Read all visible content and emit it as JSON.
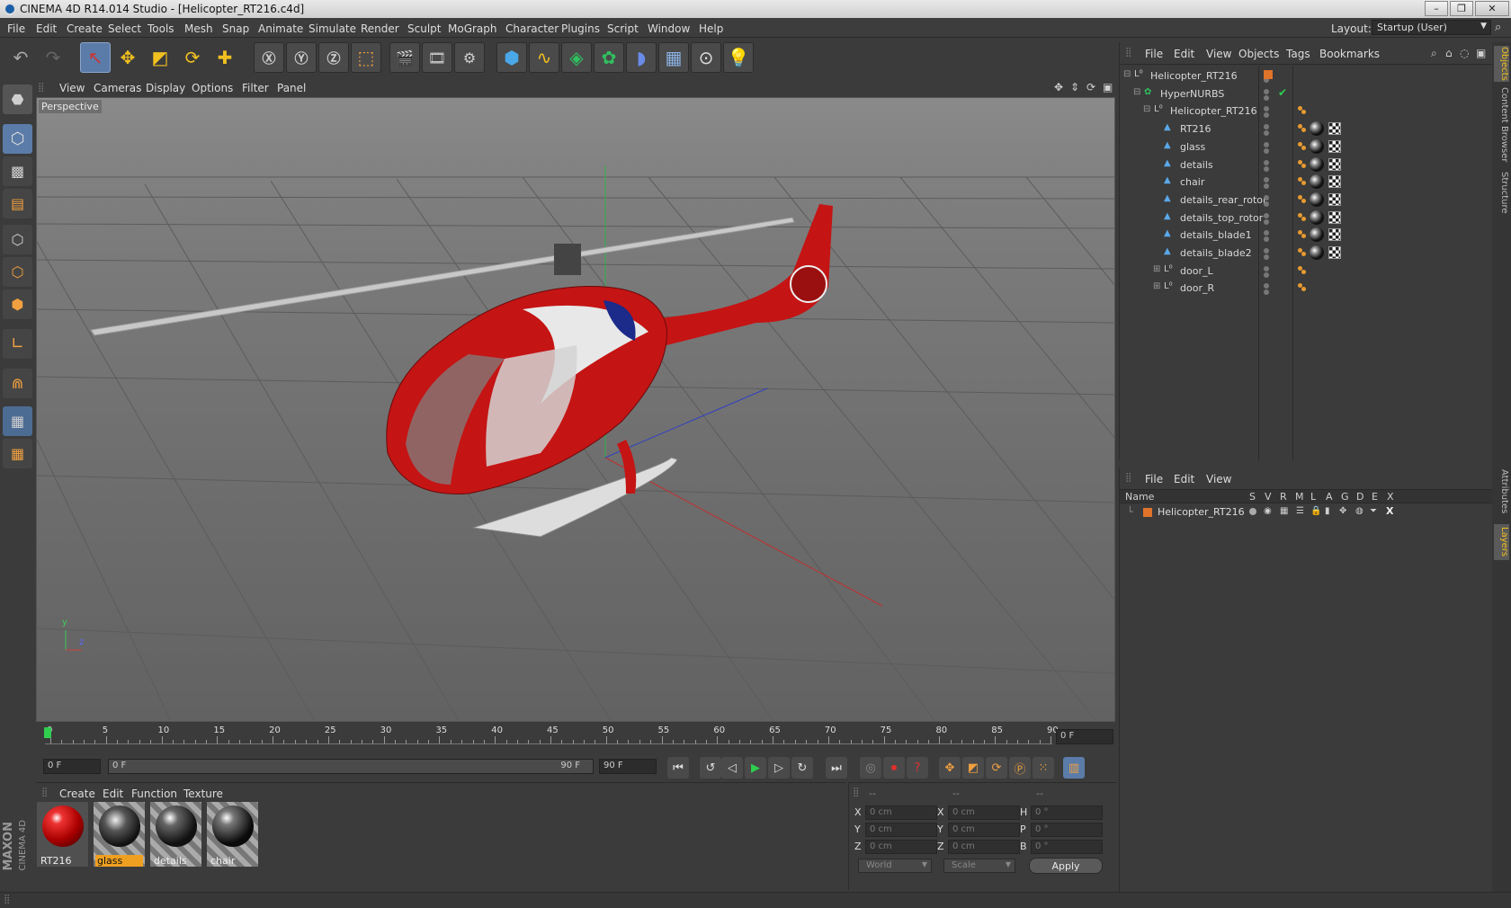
{
  "window": {
    "title": "CINEMA 4D R14.014 Studio - [Helicopter_RT216.c4d]"
  },
  "menubar": [
    "File",
    "Edit",
    "Create",
    "Select",
    "Tools",
    "Mesh",
    "Snap",
    "Animate",
    "Simulate",
    "Render",
    "Sculpt",
    "MoGraph",
    "Character",
    "Plugins",
    "Script",
    "Window",
    "Help"
  ],
  "layout": {
    "label": "Layout:",
    "value": "Startup (User)"
  },
  "viewport": {
    "menu": [
      "View",
      "Cameras",
      "Display",
      "Options",
      "Filter",
      "Panel"
    ],
    "label": "Perspective",
    "axis_y": "y",
    "axis_z": "z"
  },
  "objects_panel": {
    "menu": [
      "File",
      "Edit",
      "View",
      "Objects",
      "Tags",
      "Bookmarks"
    ],
    "items": [
      {
        "name": "Helicopter_RT216",
        "type": "null"
      },
      {
        "name": "HyperNURBS",
        "type": "hypernurbs"
      },
      {
        "name": "Helicopter_RT216",
        "type": "null"
      },
      {
        "name": "RT216",
        "type": "mesh"
      },
      {
        "name": "glass",
        "type": "mesh"
      },
      {
        "name": "details",
        "type": "mesh"
      },
      {
        "name": "chair",
        "type": "mesh"
      },
      {
        "name": "details_rear_rotor",
        "type": "mesh"
      },
      {
        "name": "details_top_rotor",
        "type": "mesh"
      },
      {
        "name": "details_blade1",
        "type": "mesh"
      },
      {
        "name": "details_blade2",
        "type": "mesh"
      },
      {
        "name": "door_L",
        "type": "null"
      },
      {
        "name": "door_R",
        "type": "null"
      }
    ]
  },
  "layers_panel": {
    "menu": [
      "File",
      "Edit",
      "View"
    ],
    "header": {
      "name": "Name",
      "flags": [
        "S",
        "V",
        "R",
        "M",
        "L",
        "A",
        "G",
        "D",
        "E",
        "X"
      ]
    },
    "rows": [
      {
        "name": "Helicopter_RT216",
        "color": "#e0742a"
      }
    ]
  },
  "side_tabs": [
    "Objects",
    "Content Browser",
    "Structure",
    "Attributes",
    "Layers"
  ],
  "timeline": {
    "ticks": [
      "0",
      "5",
      "10",
      "15",
      "20",
      "25",
      "30",
      "35",
      "40",
      "45",
      "50",
      "55",
      "60",
      "65",
      "70",
      "75",
      "80",
      "85",
      "90"
    ],
    "current_frame": "0 F",
    "start_field": "0 F",
    "range_left": "0 F",
    "range_right": "90 F",
    "end_field": "90 F"
  },
  "materials": {
    "menu": [
      "Create",
      "Edit",
      "Function",
      "Texture"
    ],
    "items": [
      {
        "name": "RT216",
        "selected": false
      },
      {
        "name": "glass",
        "selected": true
      },
      {
        "name": "details",
        "selected": false
      },
      {
        "name": "chair",
        "selected": false
      }
    ]
  },
  "coordinates": {
    "header": [
      "--",
      "--",
      "--"
    ],
    "rows": [
      {
        "a": "X",
        "av": "0 cm",
        "b": "X",
        "bv": "0 cm",
        "c": "H",
        "cv": "0 °"
      },
      {
        "a": "Y",
        "av": "0 cm",
        "b": "Y",
        "bv": "0 cm",
        "c": "P",
        "cv": "0 °"
      },
      {
        "a": "Z",
        "av": "0 cm",
        "b": "Z",
        "bv": "0 cm",
        "c": "B",
        "cv": "0 °"
      }
    ],
    "mode1": "World",
    "mode2": "Scale",
    "apply": "Apply"
  },
  "branding": {
    "maxon": "MAXON",
    "product": "CINEMA 4D"
  },
  "colors": {
    "accent": "#5b7ca8",
    "helicopter": "#c51414",
    "layer": "#e0742a"
  }
}
